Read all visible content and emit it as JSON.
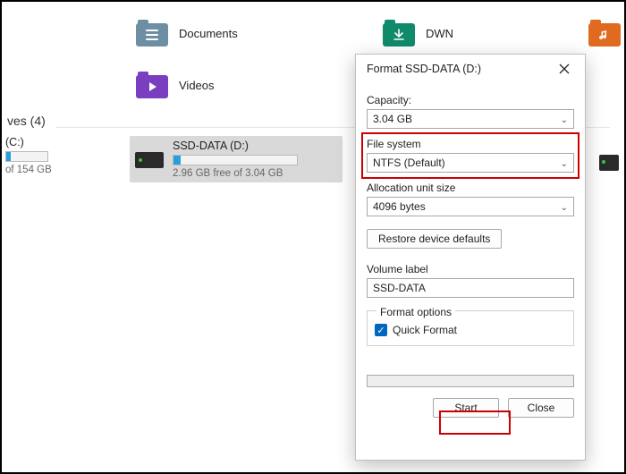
{
  "folders": {
    "documents": {
      "label": "Documents",
      "color_tab": "#6e8fa3",
      "color_body": "#6e8fa3"
    },
    "dwn": {
      "label": "DWN",
      "color_tab": "#0f8a6a",
      "color_body": "#0f8a6a"
    },
    "music": {
      "label": "",
      "color_tab": "#e06a1f",
      "color_body": "#e06a1f"
    },
    "videos": {
      "label": "Videos",
      "color_tab": "#7a3fbf",
      "color_body": "#7a3fbf"
    }
  },
  "drives_header": "ves (4)",
  "drives": {
    "c": {
      "name": "(C:)",
      "sub": "of 154 GB",
      "fill_pct": 10
    },
    "d": {
      "name": "SSD-DATA (D:)",
      "sub": "2.96 GB free of 3.04 GB",
      "fill_pct": 6
    }
  },
  "dialog": {
    "title": "Format SSD-DATA (D:)",
    "capacity_label": "Capacity:",
    "capacity_value": "3.04 GB",
    "filesystem_label": "File system",
    "filesystem_value": "NTFS (Default)",
    "allocation_label": "Allocation unit size",
    "allocation_value": "4096 bytes",
    "restore_label": "Restore device defaults",
    "volume_label_label": "Volume label",
    "volume_label_value": "SSD-DATA",
    "format_options_label": "Format options",
    "quick_format_label": "Quick Format",
    "start_label": "Start",
    "close_label": "Close"
  }
}
